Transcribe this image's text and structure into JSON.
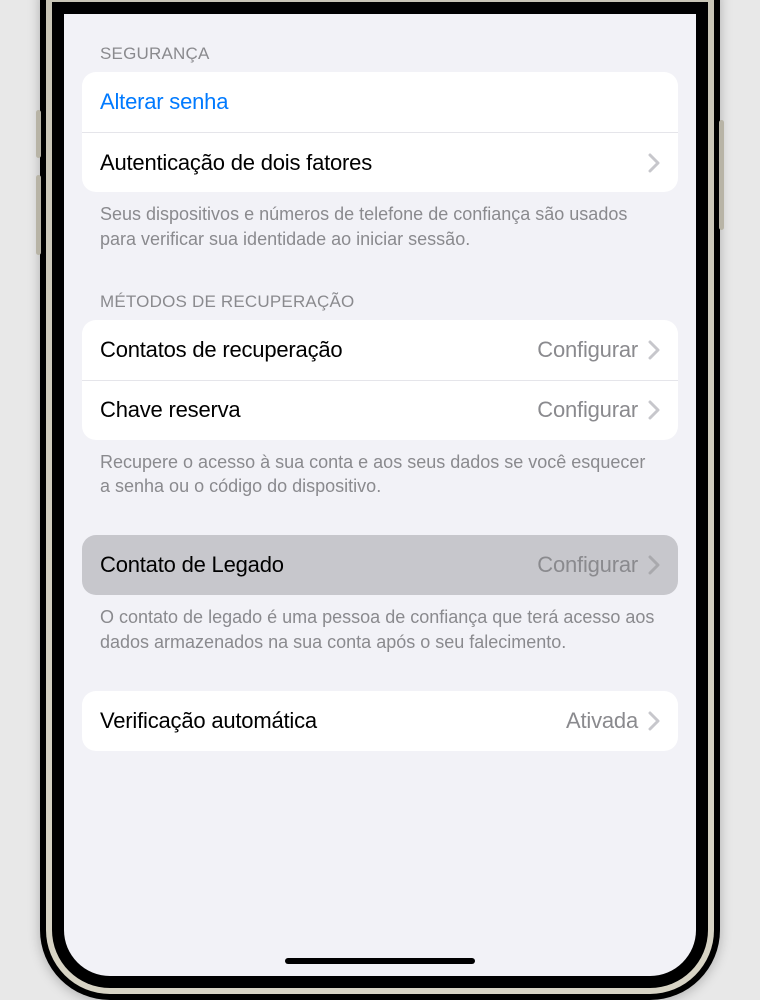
{
  "sections": {
    "security": {
      "header": "SEGURANÇA",
      "rows": {
        "change_password": "Alterar senha",
        "two_factor": "Autenticação de dois fatores"
      },
      "footer": "Seus dispositivos e números de telefone de confiança são usados para verificar sua identidade ao iniciar sessão."
    },
    "recovery": {
      "header": "MÉTODOS DE RECUPERAÇÃO",
      "rows": {
        "recovery_contacts": {
          "label": "Contatos de recuperação",
          "value": "Configurar"
        },
        "recovery_key": {
          "label": "Chave reserva",
          "value": "Configurar"
        }
      },
      "footer": "Recupere o acesso à sua conta e aos seus dados se você esquecer a senha ou o código do dispositivo."
    },
    "legacy": {
      "row": {
        "label": "Contato de Legado",
        "value": "Configurar"
      },
      "footer": "O contato de legado é uma pessoa de confiança que terá acesso aos dados armazenados na sua conta após o seu falecimento."
    },
    "auto_verification": {
      "row": {
        "label": "Verificação automática",
        "value": "Ativada"
      }
    }
  }
}
